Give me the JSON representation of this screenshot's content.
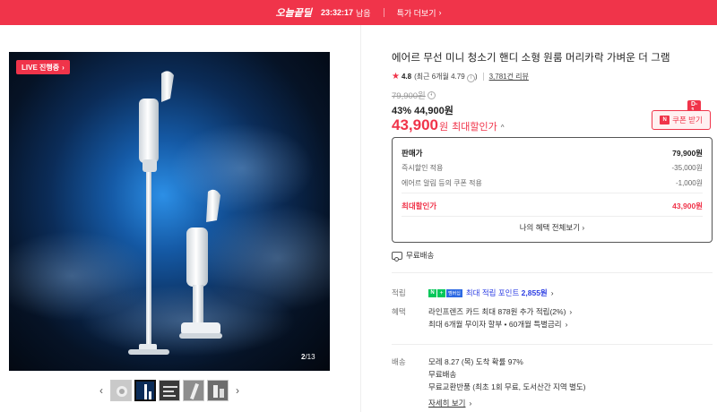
{
  "banner": {
    "badge": "오늘끝딜",
    "timer": "23:32:17",
    "timer_suffix": "남음",
    "more": "특가 더보기"
  },
  "gallery": {
    "live_label": "LIVE 진행중",
    "page_current": "2",
    "page_total": "/13",
    "thumbnail_count": 5,
    "selected_thumbnail": 2
  },
  "product": {
    "title": "에어르 무선 미니 청소기 핸디 소형 원룸 머리카락 가벼운 더 그램",
    "rating": "4.8",
    "rating_recent": "(최근 6개월 4.79",
    "review_count": "3,781건 리뷰",
    "original_price": "79,900원",
    "sale_line": "43% 44,900원",
    "max_price": "43,900",
    "max_price_unit": "원",
    "max_price_label": "최대할인가",
    "coupon_dday": "D-1",
    "coupon_label": "쿠폰 받기",
    "coupon_icon": "N"
  },
  "price_box": {
    "rows": [
      {
        "label": "판매가",
        "value": "79,900원"
      },
      {
        "label": "즉시할인 적용",
        "value": "-35,000원"
      },
      {
        "label": "에어르 알림 등의 쿠폰 적용",
        "value": "-1,000원"
      },
      {
        "label": "최대할인가",
        "value": "43,900원"
      }
    ],
    "benefit_link": "나의 혜택 전체보기"
  },
  "shipping_badge": "무료배송",
  "points": {
    "label": "적립",
    "npay_n": "N",
    "npay_plus": "+",
    "npay_member": "멤버십",
    "text": "최대 적립 포인트",
    "amount": "2,855원"
  },
  "benefits": {
    "label": "혜택",
    "line1": "라인프렌즈 카드 최대 878원 추가 적립(2%)",
    "line2": "최대 6개월 무이자 할부 • 60개월 특별금리"
  },
  "delivery": {
    "label": "배송",
    "line1": "모레 8.27 (목) 도착 확률 97%",
    "line2": "무료배송",
    "line3": "무료교환반품 (최초 1회 무료, 도서산간 지역 별도)",
    "detail_link": "자세히 보기"
  },
  "colors": {
    "brand_red": "#f0344a",
    "npay_green": "#03c75a",
    "point_blue": "#2d3ee3"
  }
}
